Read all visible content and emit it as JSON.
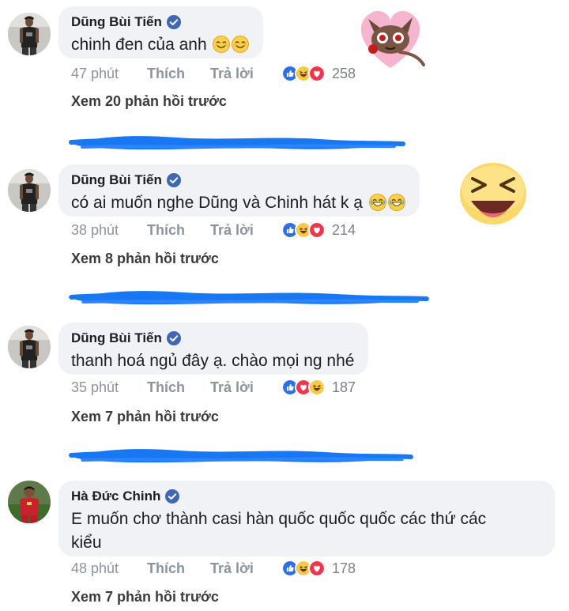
{
  "colors": {
    "link_blue": "#3b5998",
    "verified_blue": "#4267b2",
    "scribble_blue": "#1877f2",
    "bubble_bg": "#f0f2f5"
  },
  "comments": [
    {
      "author": "Dũng Bùi Tiến",
      "text": "chinh đen của anh",
      "emoji": [
        "smiling-face-icon",
        "smiling-face-icon"
      ],
      "time": "47 phút",
      "like": "Thích",
      "reply": "Trả lời",
      "reactions": [
        "like-reaction-icon",
        "haha-reaction-icon",
        "love-reaction-icon"
      ],
      "reaction_count": "258",
      "view_previous": "Xem 20 phản hồi trước",
      "redacted_reply": "redacted-reply-scribble"
    },
    {
      "author": "Dũng Bùi Tiến",
      "text": "có ai muốn nghe Dũng và Chinh hát k ạ",
      "emoji": [
        "grinning-face-icon",
        "grinning-face-icon"
      ],
      "time": "38 phút",
      "like": "Thích",
      "reply": "Trả lời",
      "reactions": [
        "like-reaction-icon",
        "haha-reaction-icon",
        "love-reaction-icon"
      ],
      "reaction_count": "214",
      "view_previous": "Xem 8 phản hồi trước",
      "redacted_reply": "redacted-reply-scribble"
    },
    {
      "author": "Dũng Bùi Tiến",
      "text": "thanh hoá ngủ đây ạ. chào mọi ng nhé",
      "time": "35 phút",
      "like": "Thích",
      "reply": "Trả lời",
      "reactions": [
        "like-reaction-icon",
        "love-reaction-icon",
        "haha-reaction-icon"
      ],
      "reaction_count": "187",
      "view_previous": "Xem 7 phản hồi trước",
      "redacted_reply": "redacted-reply-scribble"
    },
    {
      "author": "Hà Đức Chinh",
      "text_line1": "E muốn chơ thành casi hàn quốc quốc quốc các thứ các",
      "text_line2": "kiểu",
      "time": "48 phút",
      "like": "Thích",
      "reply": "Trả lời",
      "reactions": [
        "like-reaction-icon",
        "haha-reaction-icon",
        "love-reaction-icon"
      ],
      "reaction_count": "178",
      "view_previous": "Xem 7 phản hồi trước"
    }
  ],
  "stickers": [
    "cat-sticker",
    "laughing-emoji-sticker"
  ]
}
